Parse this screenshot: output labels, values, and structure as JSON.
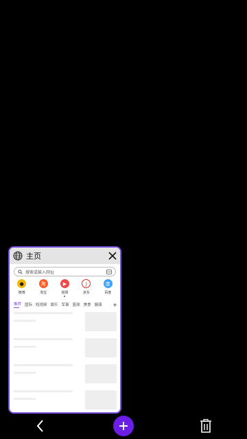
{
  "card": {
    "title": "主页",
    "search_placeholder": "搜索或输入网址",
    "shortcuts": [
      {
        "label": "微博",
        "icon": "weibo-icon",
        "color": "#f5b800"
      },
      {
        "label": "淘宝",
        "icon": "taobao-icon",
        "color": "#ff5a1f"
      },
      {
        "label": "视频",
        "icon": "video-icon",
        "color": "#f04848"
      },
      {
        "label": "京东",
        "icon": "jd-icon",
        "color": "#e1251b"
      },
      {
        "label": "百度",
        "icon": "baidu-icon",
        "color": "#3aa0ff"
      }
    ],
    "tabs": [
      "推荐",
      "国际",
      "短视频",
      "娱乐",
      "军事",
      "篮球",
      "美食",
      "健康"
    ],
    "accent_color": "#7b4fe0"
  },
  "bottom": {
    "add_color": "#6a1ee6"
  }
}
